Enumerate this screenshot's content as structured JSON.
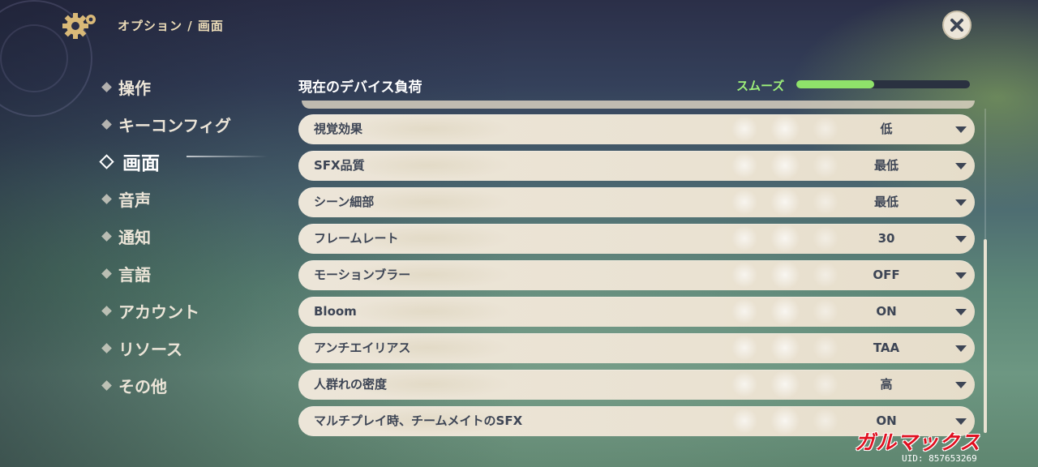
{
  "breadcrumb": "オプション / 画面",
  "sidebar": {
    "items": [
      {
        "label": "操作",
        "active": false
      },
      {
        "label": "キーコンフィグ",
        "active": false
      },
      {
        "label": "画面",
        "active": true
      },
      {
        "label": "音声",
        "active": false
      },
      {
        "label": "通知",
        "active": false
      },
      {
        "label": "言語",
        "active": false
      },
      {
        "label": "アカウント",
        "active": false
      },
      {
        "label": "リソース",
        "active": false
      },
      {
        "label": "その他",
        "active": false
      }
    ]
  },
  "device_load": {
    "title": "現在のデバイス負荷",
    "status": "スムーズ",
    "level": 0.45,
    "status_color": "#9ef07a"
  },
  "settings": [
    {
      "label": "視覚効果",
      "value": "低"
    },
    {
      "label": "SFX品質",
      "value": "最低"
    },
    {
      "label": "シーン細部",
      "value": "最低"
    },
    {
      "label": "フレームレート",
      "value": "30"
    },
    {
      "label": "モーションブラー",
      "value": "OFF"
    },
    {
      "label": "Bloom",
      "value": "ON"
    },
    {
      "label": "アンチエイリアス",
      "value": "TAA"
    },
    {
      "label": "人群れの密度",
      "value": "高"
    },
    {
      "label": "マルチプレイ時、チームメイトのSFX",
      "value": "ON"
    }
  ],
  "watermark": {
    "logo": "ガルマックス",
    "uid": "UID: 857653269",
    "logo_color": "#e01020"
  },
  "icons": {
    "settings": "gear-icon",
    "close": "close-icon",
    "dropdown": "chevron-down-icon"
  }
}
